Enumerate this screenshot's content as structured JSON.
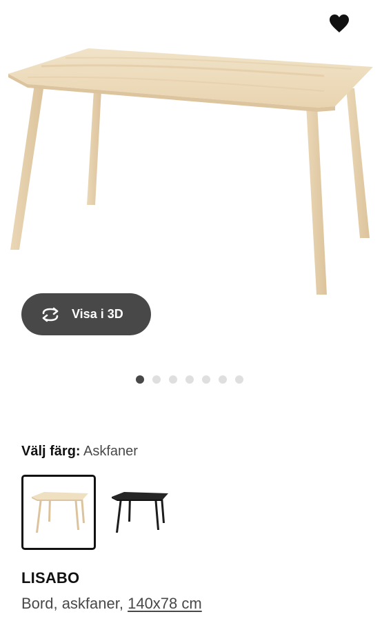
{
  "view_3d": {
    "label": "Visa i 3D"
  },
  "carousel": {
    "total_slides": 7,
    "active_index": 0
  },
  "color_selector": {
    "label": "Välj färg:",
    "selected_value": "Askfaner",
    "options": [
      {
        "finish": "ash veneer",
        "selected": true
      },
      {
        "finish": "black",
        "selected": false
      }
    ]
  },
  "product": {
    "name": "LISABO",
    "description": "Bord, askfaner, ",
    "size": "140x78 cm"
  },
  "colors": {
    "button_bg": "#484848",
    "text_primary": "#111111",
    "text_secondary": "#484848",
    "dot_active": "#484848",
    "dot_inactive": "#dfdfdf",
    "wood": "#ecd9b9",
    "black_finish": "#1c1c1c"
  }
}
